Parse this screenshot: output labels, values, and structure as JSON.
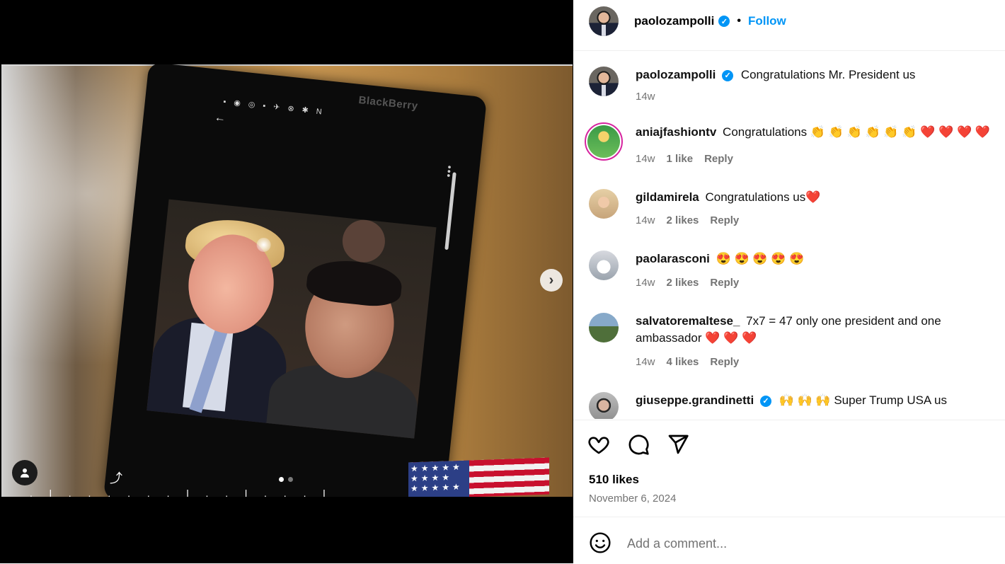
{
  "post": {
    "username": "paolozampolli",
    "follow_label": "Follow",
    "separator": "•"
  },
  "media": {
    "phone_brand": "BlackBerry",
    "caption_scrawl": ". l . . . .  . . l . . l . . . l",
    "carousel_total": 2,
    "carousel_active": 1,
    "next_glyph": "›"
  },
  "comments": [
    {
      "user": "paolozampolli",
      "text": "Congratulations Mr. President us",
      "time": "14w",
      "likes": "",
      "reply": "",
      "verified": true
    },
    {
      "user": "aniajfashiontv",
      "text": "Congratulations 👏 👏 👏 👏 👏 👏 ❤️ ❤️ ❤️ ❤️",
      "time": "14w",
      "likes": "1 like",
      "reply": "Reply",
      "verified": false
    },
    {
      "user": "gildamirela",
      "text": "Congratulations us❤️",
      "time": "14w",
      "likes": "2 likes",
      "reply": "Reply",
      "verified": false
    },
    {
      "user": "paolarasconi",
      "text": "😍 😍 😍 😍 😍",
      "time": "14w",
      "likes": "2 likes",
      "reply": "Reply",
      "verified": false
    },
    {
      "user": "salvatoremaltese_",
      "text": "7x7 = 47 only one president and one ambassador ❤️ ❤️ ❤️",
      "time": "14w",
      "likes": "4 likes",
      "reply": "Reply",
      "verified": false
    },
    {
      "user": "giuseppe.grandinetti",
      "text": "🙌 🙌 🙌  Super Trump USA us",
      "time": "",
      "likes": "",
      "reply": "",
      "verified": true
    }
  ],
  "stats": {
    "likes": "510 likes",
    "date": "November 6, 2024"
  },
  "add_comment": {
    "placeholder": "Add a comment..."
  },
  "icons": {
    "like": "heart-icon",
    "comment": "comment-icon",
    "share": "send-icon",
    "emoji": "emoji-icon",
    "tag": "user-tag-icon",
    "next": "chevron-right-icon"
  },
  "colors": {
    "accent": "#0095f6",
    "heart": "#e0142b",
    "muted": "#737373"
  }
}
